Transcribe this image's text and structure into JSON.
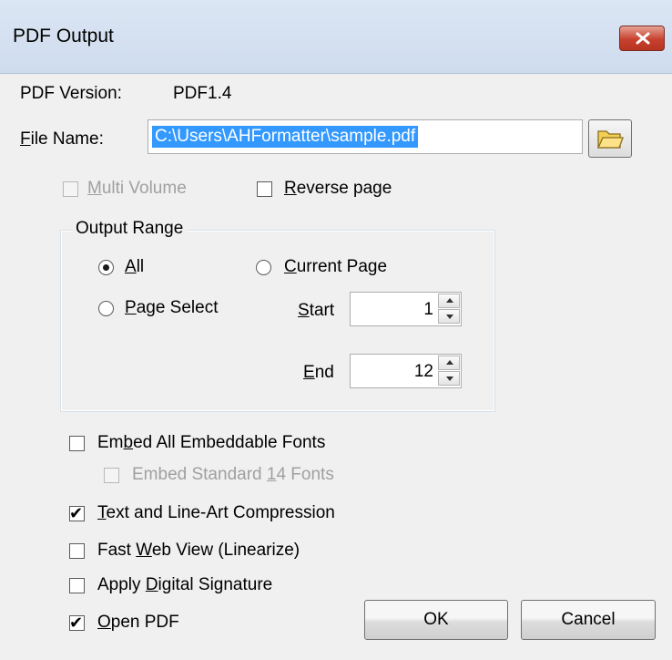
{
  "window": {
    "title": "PDF Output"
  },
  "pdf_version": {
    "label": "PDF Version:",
    "value": "PDF1.4"
  },
  "file_name": {
    "label_u": "F",
    "label_rest": "ile Name:",
    "value": "C:\\Users\\AHFormatter\\sample.pdf"
  },
  "options_top": {
    "multi_volume": {
      "u": "M",
      "rest": "ulti Volume",
      "checked": false,
      "enabled": false
    },
    "reverse_page": {
      "u": "R",
      "rest": "everse page",
      "checked": false,
      "enabled": true
    }
  },
  "output_range": {
    "legend": "Output Range",
    "all": {
      "u": "A",
      "rest": "ll",
      "selected": true
    },
    "current_page": {
      "u": "C",
      "rest": "urrent Page",
      "selected": false
    },
    "page_select": {
      "u": "P",
      "rest": "age Select",
      "selected": false
    },
    "start": {
      "u": "S",
      "rest": "tart",
      "value": "1"
    },
    "end": {
      "u": "E",
      "rest": "nd",
      "value": "12"
    }
  },
  "options": {
    "embed_all": {
      "pre": "Em",
      "u": "b",
      "post": "ed All Embeddable Fonts",
      "checked": false
    },
    "embed_std": {
      "pre": "Embed Standard ",
      "u": "1",
      "post": "4 Fonts",
      "checked": false,
      "enabled": false
    },
    "compression": {
      "pre": "",
      "u": "T",
      "post": "ext and Line-Art Compression",
      "checked": true
    },
    "fast_web": {
      "pre": "Fast ",
      "u": "W",
      "post": "eb View (Linearize)",
      "checked": false
    },
    "digital_sig": {
      "pre": "Apply ",
      "u": "D",
      "post": "igital Signature",
      "checked": false
    },
    "open_pdf": {
      "pre": "",
      "u": "O",
      "post": "pen PDF",
      "checked": true
    }
  },
  "buttons": {
    "ok": "OK",
    "cancel": "Cancel"
  },
  "check_glyph": "✔"
}
